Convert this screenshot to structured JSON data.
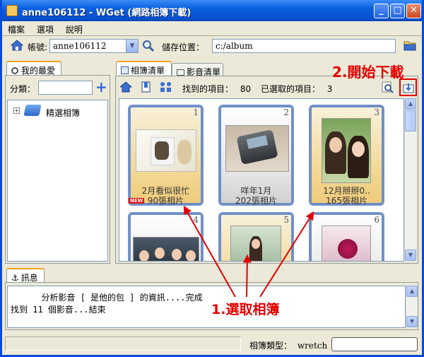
{
  "window": {
    "title": "anne106112 - WGet (網路相簿下載)"
  },
  "menu": {
    "items": [
      "檔案",
      "選項",
      "說明"
    ]
  },
  "toolbar": {
    "account_label": "帳號:",
    "account_value": "anne106112",
    "save_location_label": "儲存位置：",
    "save_location_value": "c:/album"
  },
  "left_panel": {
    "tab_label": "我的最愛",
    "category_label": "分類：",
    "category_value": "",
    "tree": [
      {
        "label": "精選相簿"
      }
    ]
  },
  "main": {
    "tabs": [
      {
        "label": "相簿清單",
        "active": true
      },
      {
        "label": "影音清單",
        "active": false
      }
    ],
    "found_label": "找到的項目：",
    "found_count": "80",
    "selected_label": "已選取的項目：",
    "selected_count": "3",
    "albums": [
      {
        "index": "1",
        "title": "2月看似很忙",
        "count": "90張相片",
        "selected": true,
        "is_new": true,
        "new_label": "NEW"
      },
      {
        "index": "2",
        "title": "咩年1月",
        "count": "202張相片",
        "selected": false
      },
      {
        "index": "3",
        "title": "12月掰掰0..",
        "count": "165張相片",
        "selected": true
      },
      {
        "index": "4",
        "title": "",
        "count": "",
        "selected": false
      },
      {
        "index": "5",
        "title": "",
        "count": "",
        "selected": true
      },
      {
        "index": "6",
        "title": "",
        "count": "",
        "selected": false
      }
    ]
  },
  "messages": {
    "tab_label": "訊息",
    "lines": [
      "      分析影音 [ 是他的包 ] 的資訊....完成",
      "找到 11 個影音...結束"
    ]
  },
  "status": {
    "album_type_label": "相簿類型：",
    "album_type_value": "wretch"
  },
  "annotations": {
    "start_download": "2.開始下載",
    "select_album": "1.選取相簿"
  },
  "colors": {
    "annotation": "#e30000",
    "title_bar": "#0a5fe0",
    "selected_thumb": "#f3d690"
  }
}
